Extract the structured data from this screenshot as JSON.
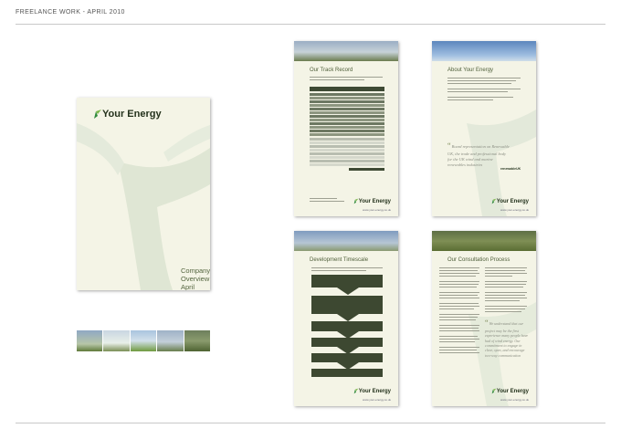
{
  "header": {
    "title": "FREELANCE WORK - APRIL 2010"
  },
  "brand": {
    "name": "Your Energy",
    "url": "www.your-energy.co.uk",
    "accent": "#2f8a3c",
    "dark": "#24321c"
  },
  "cover": {
    "title_line1": "Company Overview",
    "title_line2": "April 2010"
  },
  "pages": {
    "track_record": {
      "title": "Our Track Record",
      "intro": "Our team has been involved during the development, completion or financing of the following projects:",
      "table_headers": [
        "Project",
        "Local Planning Authority",
        "No of Turbines",
        "MW",
        "Status"
      ]
    },
    "about": {
      "title": "About Your Energy",
      "quote": "Board representation on Renewable UK, the trade and professional body for the UK wind and marine renewables industries",
      "quote_logo": "renewableUK"
    },
    "timescale": {
      "title": "Development Timescale",
      "steps": [
        "Stage 1",
        "Stage 2",
        "Stage 3",
        "Stage 4",
        "Stage 5",
        "Stage 6"
      ]
    },
    "consultation": {
      "title": "Our Consultation Process",
      "quote": "We understand that our project may be the first experience many people have had of wind energy. Our commitment to engage in clear, open, and encourage two-way communication"
    }
  }
}
